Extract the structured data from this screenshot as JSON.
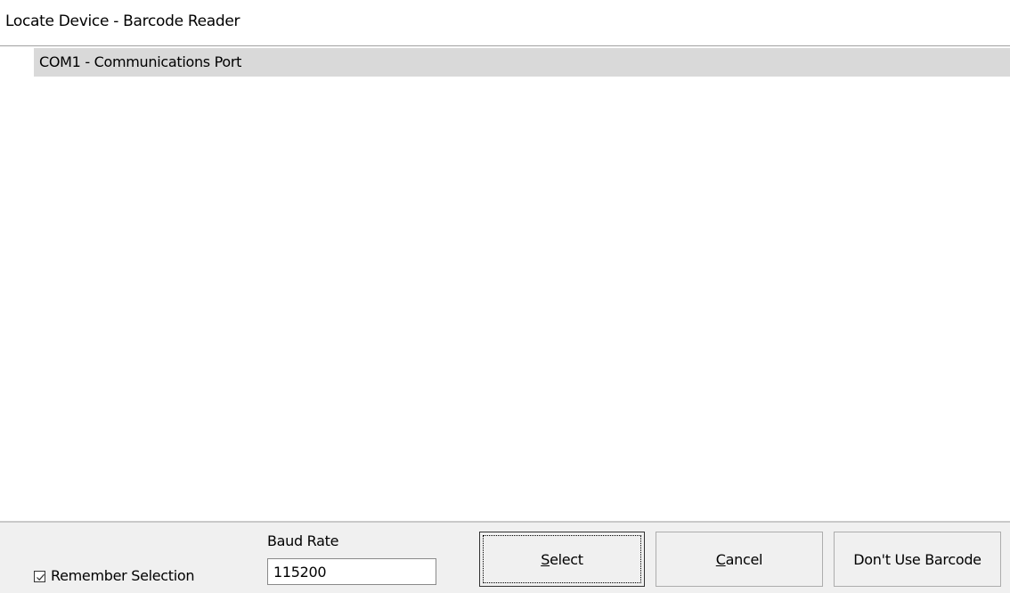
{
  "window": {
    "title": "Locate Device - Barcode Reader"
  },
  "device_list": {
    "items": [
      {
        "label": "COM1 - Communications Port",
        "selected": true
      }
    ]
  },
  "bottom_bar": {
    "remember_selection": {
      "label": "Remember Selection",
      "checked": true
    },
    "baud_rate": {
      "label": "Baud Rate",
      "value": "115200"
    },
    "buttons": {
      "select": {
        "mnemonic": "S",
        "rest": "elect"
      },
      "cancel": {
        "mnemonic": "C",
        "rest": "ancel"
      },
      "dont_use_barcode": {
        "label": "Don't Use Barcode"
      }
    }
  },
  "colors": {
    "selected_row_bg": "#d9d9d9",
    "bar_bg": "#f0f0f0",
    "button_border": "#adadad"
  },
  "icons": {
    "checkbox_check": "check-mark-icon"
  }
}
